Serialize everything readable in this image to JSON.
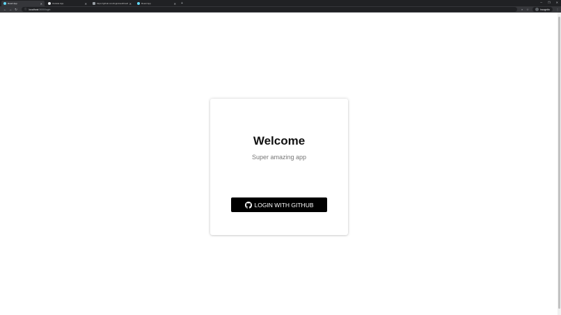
{
  "browser": {
    "tabs": [
      {
        "title": "React App",
        "icon": "react-icon",
        "active": true
      },
      {
        "title": "Outside App",
        "icon": "github-icon",
        "active": false
      },
      {
        "title": "https://github.com/login/oauth/authorize",
        "icon": "page-icon",
        "active": false
      },
      {
        "title": "React App",
        "icon": "react-icon",
        "active": false
      }
    ],
    "new_tab": "+",
    "omnibox": {
      "host": "localhost",
      "path": ":3000/login"
    },
    "profile_label": "Incognito"
  },
  "page": {
    "title": "Welcome",
    "subtitle": "Super amazing app",
    "login_button_label": "LOGIN WITH GITHUB"
  },
  "colors": {
    "button_bg": "#000000",
    "button_text": "#ffffff",
    "title": "#111111",
    "subtitle": "#777777"
  }
}
